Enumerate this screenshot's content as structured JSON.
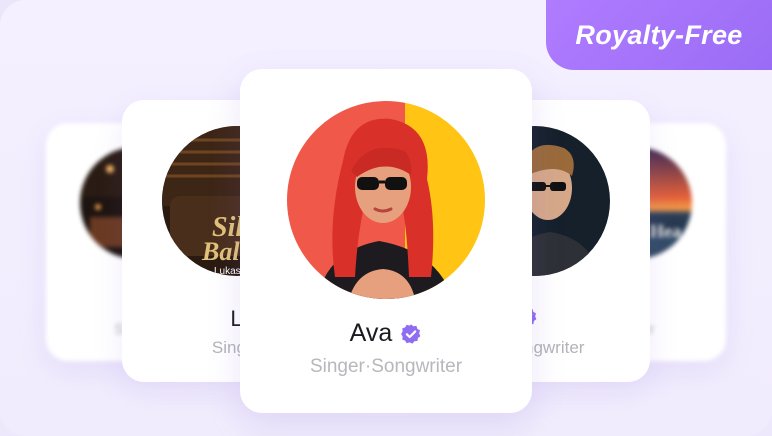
{
  "badge": {
    "label": "Royalty-Free"
  },
  "cards": {
    "far_left": {
      "role": "Singer",
      "avatar_icon": "concert-guitarist-photo-icon"
    },
    "near_left": {
      "name": "Lia",
      "role": "Singer·S",
      "cover_title_line1": "Sil",
      "cover_title_line2": "Bal",
      "cover_artist": "Lukas",
      "avatar_icon": "album-cover-photo-icon"
    },
    "center": {
      "name": "Ava",
      "role": "Singer·Songwriter",
      "verified": true,
      "avatar_icon": "woman-sunglasses-portrait-icon"
    },
    "near_right": {
      "role": "ngwriter",
      "verified": true,
      "avatar_icon": "man-sunglasses-portrait-icon"
    },
    "far_right": {
      "role": "writer",
      "cover_text": "Hea",
      "avatar_icon": "ocean-sunset-cover-icon"
    }
  },
  "colors": {
    "accent": "#9a6cf5",
    "verified": "#8f6cf2",
    "role_text": "#b3b3b8"
  }
}
